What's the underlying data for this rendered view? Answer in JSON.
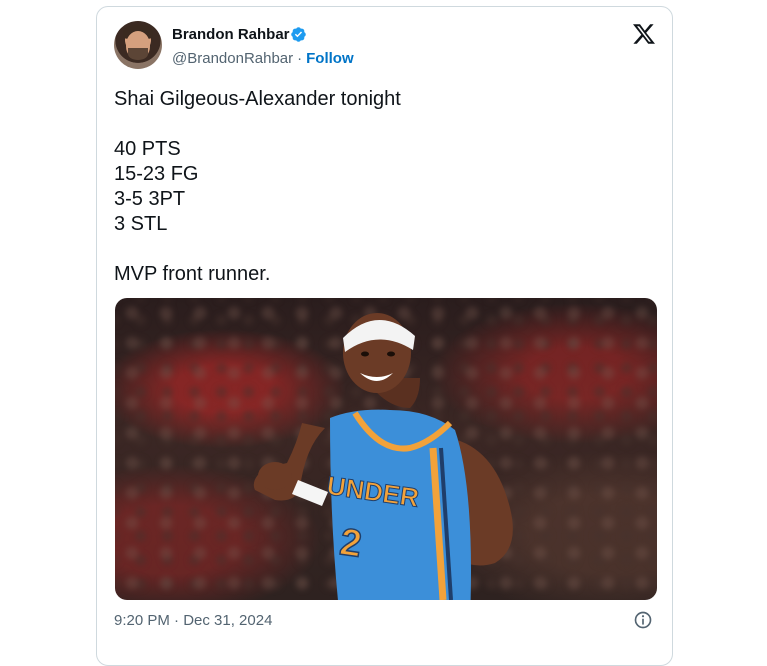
{
  "author": {
    "name": "Brandon Rahbar",
    "handle": "@BrandonRahbar",
    "separator": "·",
    "follow_label": "Follow",
    "verified": true,
    "verified_color": "#1d9bf0"
  },
  "tweet": {
    "lines": [
      "Shai Gilgeous-Alexander tonight",
      "",
      "40 PTS",
      "15-23 FG",
      "3-5 3PT",
      "3 STL",
      "",
      "MVP front runner."
    ],
    "timestamp": "9:20 PM · Dec 31, 2024"
  },
  "media": {
    "jersey_text": "UNDER",
    "jersey_number": "2",
    "jersey_color": "#3c8fd9"
  },
  "icons": {
    "logo": "x-logo-icon",
    "info": "info-icon",
    "verified": "verified-badge-icon"
  },
  "colors": {
    "link": "#0074c7",
    "muted": "#536471",
    "text": "#0f1419",
    "border": "#cfd9de"
  }
}
